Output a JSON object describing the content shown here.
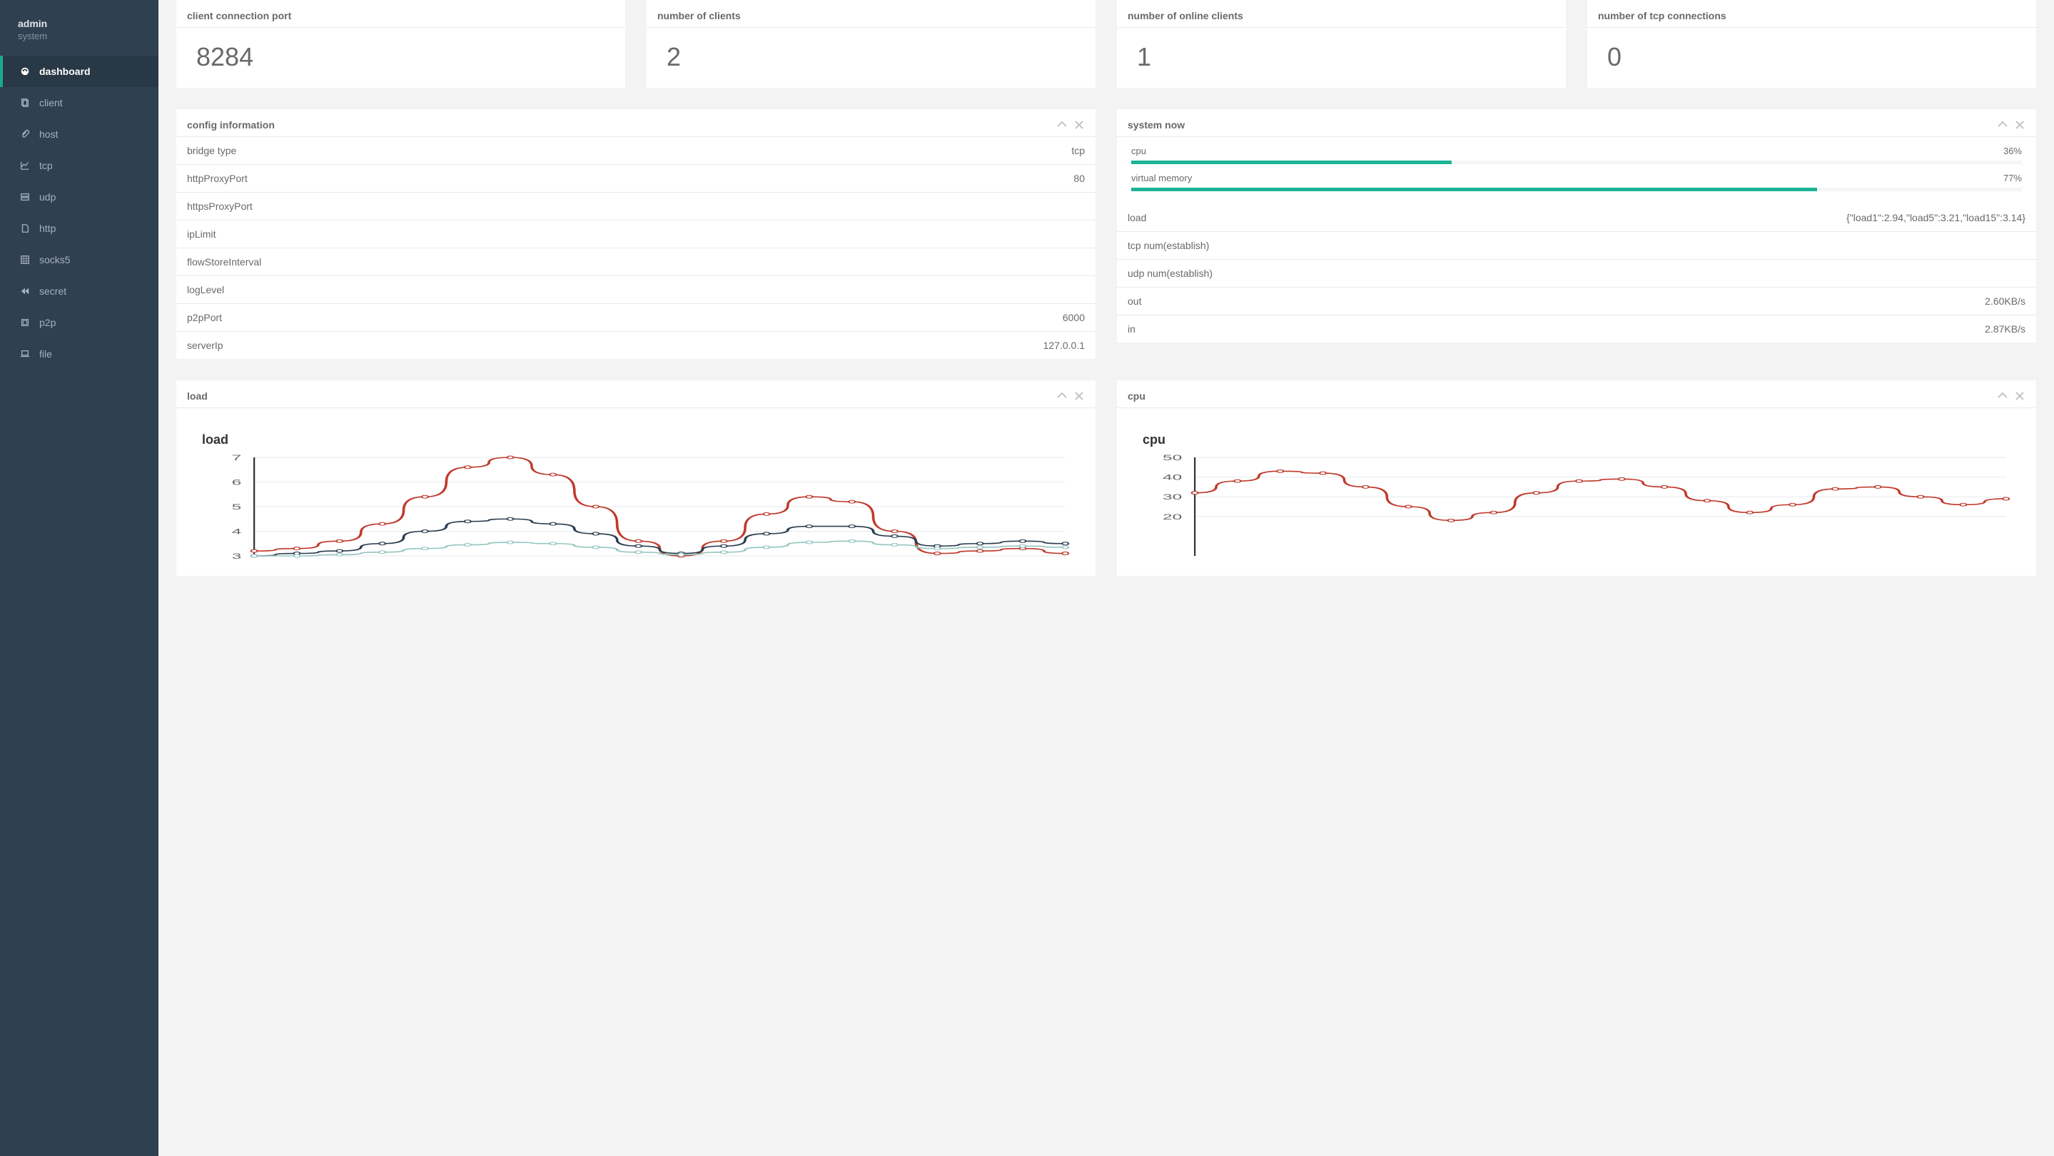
{
  "sidebar": {
    "title": "admin",
    "subtitle": "system",
    "items": [
      {
        "label": "dashboard",
        "icon": "dashboard",
        "active": true,
        "name": "nav-dashboard"
      },
      {
        "label": "client",
        "icon": "copy",
        "name": "nav-client"
      },
      {
        "label": "host",
        "icon": "paperclip",
        "name": "nav-host"
      },
      {
        "label": "tcp",
        "icon": "linechart",
        "name": "nav-tcp"
      },
      {
        "label": "udp",
        "icon": "server",
        "name": "nav-udp"
      },
      {
        "label": "http",
        "icon": "file",
        "name": "nav-http"
      },
      {
        "label": "socks5",
        "icon": "grid",
        "name": "nav-socks5"
      },
      {
        "label": "secret",
        "icon": "rewind",
        "name": "nav-secret"
      },
      {
        "label": "p2p",
        "icon": "square",
        "name": "nav-p2p"
      },
      {
        "label": "file",
        "icon": "laptop",
        "name": "nav-file"
      }
    ]
  },
  "stats": [
    {
      "title": "client connection port",
      "value": "8284",
      "name": "stat-port"
    },
    {
      "title": "number of clients",
      "value": "2",
      "name": "stat-clients"
    },
    {
      "title": "number of online clients",
      "value": "1",
      "name": "stat-online"
    },
    {
      "title": "number of tcp connections",
      "value": "0",
      "name": "stat-tcp-conn"
    }
  ],
  "config": {
    "title": "config information",
    "rows": [
      {
        "k": "bridge type",
        "v": "tcp"
      },
      {
        "k": "httpProxyPort",
        "v": "80"
      },
      {
        "k": "httpsProxyPort",
        "v": ""
      },
      {
        "k": "ipLimit",
        "v": ""
      },
      {
        "k": "flowStoreInterval",
        "v": ""
      },
      {
        "k": "logLevel",
        "v": ""
      },
      {
        "k": "p2pPort",
        "v": "6000"
      },
      {
        "k": "serverIp",
        "v": "127.0.0.1"
      }
    ]
  },
  "system_now": {
    "title": "system now",
    "cpu_label": "cpu",
    "cpu_pct": 36,
    "cpu_pct_label": "36%",
    "mem_label": "virtual memory",
    "mem_pct": 77,
    "mem_pct_label": "77%",
    "rows": [
      {
        "k": "load",
        "v": "{\"load1\":2.94,\"load5\":3.21,\"load15\":3.14}"
      },
      {
        "k": "tcp num(establish)",
        "v": ""
      },
      {
        "k": "udp num(establish)",
        "v": ""
      },
      {
        "k": "out",
        "v": "2.60KB/s"
      },
      {
        "k": "in",
        "v": "2.87KB/s"
      }
    ]
  },
  "load_panel": {
    "title": "load",
    "chart_label": "load"
  },
  "cpu_panel": {
    "title": "cpu",
    "chart_label": "cpu"
  },
  "chart_data": [
    {
      "type": "line",
      "title": "load",
      "xlabel": "",
      "ylabel": "",
      "ylim": [
        3,
        7
      ],
      "yticks": [
        3,
        4,
        5,
        6,
        7
      ],
      "x": [
        0,
        1,
        2,
        3,
        4,
        5,
        6,
        7,
        8,
        9,
        10,
        11,
        12,
        13,
        14,
        15,
        16,
        17,
        18,
        19
      ],
      "series": [
        {
          "name": "load1",
          "color": "#c0392b",
          "values": [
            3.2,
            3.3,
            3.6,
            4.3,
            5.4,
            6.6,
            7.0,
            6.3,
            5.0,
            3.6,
            3.0,
            3.6,
            4.7,
            5.4,
            5.2,
            4.0,
            3.1,
            3.2,
            3.3,
            3.1
          ]
        },
        {
          "name": "load5",
          "color": "#2c3e50",
          "values": [
            3.0,
            3.1,
            3.2,
            3.5,
            4.0,
            4.4,
            4.5,
            4.3,
            3.9,
            3.4,
            3.1,
            3.4,
            3.9,
            4.2,
            4.2,
            3.8,
            3.4,
            3.5,
            3.6,
            3.5
          ]
        },
        {
          "name": "load15",
          "color": "#95c7c0",
          "values": [
            3.0,
            3.0,
            3.05,
            3.15,
            3.3,
            3.45,
            3.55,
            3.5,
            3.35,
            3.15,
            3.05,
            3.15,
            3.35,
            3.55,
            3.6,
            3.45,
            3.3,
            3.35,
            3.4,
            3.35
          ]
        }
      ]
    },
    {
      "type": "line",
      "title": "cpu",
      "xlabel": "",
      "ylabel": "",
      "ylim": [
        0,
        50
      ],
      "yticks": [
        20,
        30,
        40,
        50
      ],
      "x": [
        0,
        1,
        2,
        3,
        4,
        5,
        6,
        7,
        8,
        9,
        10,
        11,
        12,
        13,
        14,
        15,
        16,
        17,
        18,
        19
      ],
      "series": [
        {
          "name": "cpu",
          "color": "#c0392b",
          "values": [
            32,
            38,
            43,
            42,
            35,
            25,
            18,
            22,
            32,
            38,
            39,
            35,
            28,
            22,
            26,
            34,
            35,
            30,
            26,
            29
          ]
        }
      ]
    }
  ]
}
